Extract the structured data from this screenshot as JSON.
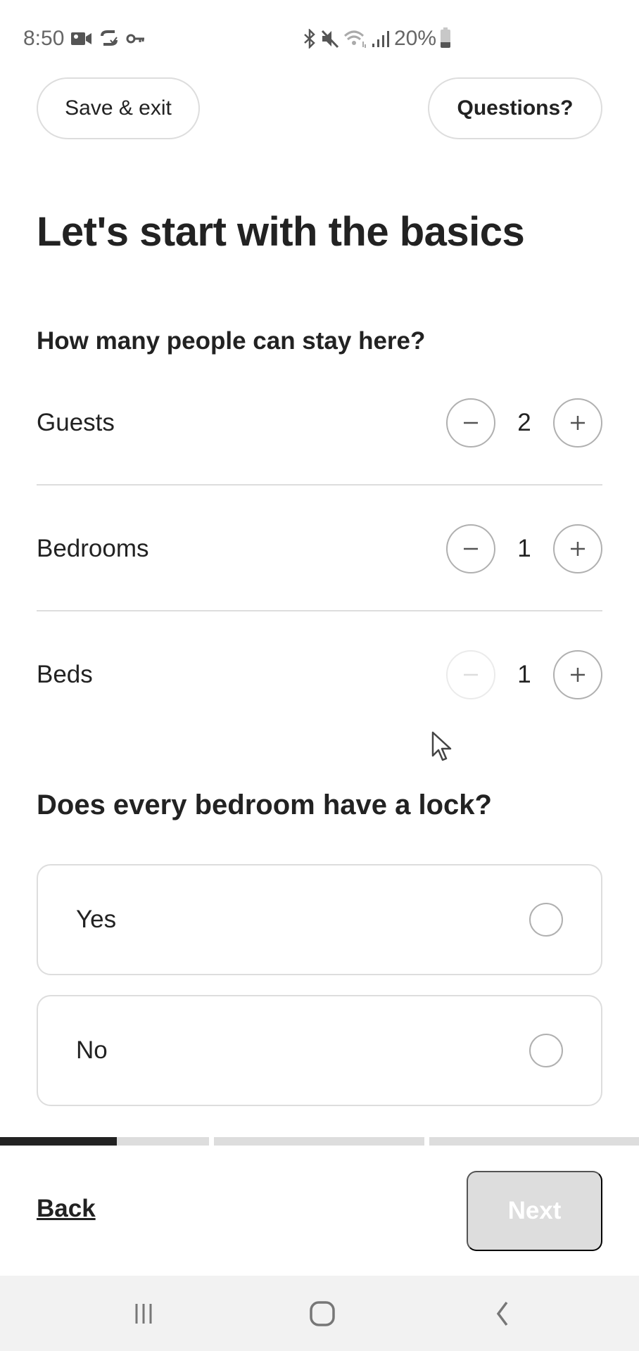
{
  "status_bar": {
    "time": "8:50",
    "left_icons": [
      "video-camera-icon",
      "sync-check-icon",
      "key-icon"
    ],
    "right_icons": [
      "bluetooth-icon",
      "mute-icon",
      "wifi-icon",
      "signal-icon"
    ],
    "battery": "20%"
  },
  "header": {
    "save_exit_label": "Save & exit",
    "questions_label": "Questions?"
  },
  "page": {
    "title": "Let's start with the basics",
    "capacity_question": "How many people can stay here?",
    "counters": [
      {
        "label": "Guests",
        "value": "2",
        "decrement_enabled": true,
        "increment_enabled": true
      },
      {
        "label": "Bedrooms",
        "value": "1",
        "decrement_enabled": true,
        "increment_enabled": true
      },
      {
        "label": "Beds",
        "value": "1",
        "decrement_enabled": false,
        "increment_enabled": true
      }
    ],
    "lock_question": "Does every bedroom have a lock?",
    "lock_options": [
      {
        "label": "Yes",
        "selected": false
      },
      {
        "label": "No",
        "selected": false
      }
    ]
  },
  "progress": {
    "segments": 3,
    "current_segment": 1,
    "current_segment_fraction": 0.56
  },
  "footer": {
    "back_label": "Back",
    "next_label": "Next",
    "next_enabled": false
  },
  "nav_bar": {
    "buttons": [
      "recents-icon",
      "home-icon",
      "back-icon"
    ]
  },
  "colors": {
    "text": "#222222",
    "border": "#dddddd",
    "disabled_bg": "#dddddd",
    "progress_fill": "#222222",
    "nav_bg": "#f2f2f2"
  }
}
